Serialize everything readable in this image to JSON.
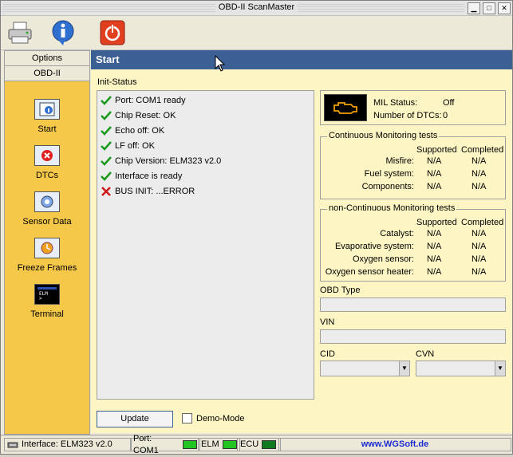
{
  "window": {
    "title": "OBD-II ScanMaster"
  },
  "toolbar": {
    "print_label": "Print",
    "info_label": "Info",
    "power_label": "Exit"
  },
  "sidebar": {
    "tabs": [
      "Options",
      "OBD-II"
    ],
    "items": [
      {
        "label": "Start",
        "icon": "start-icon"
      },
      {
        "label": "DTCs",
        "icon": "dtcs-icon"
      },
      {
        "label": "Sensor Data",
        "icon": "sensor-data-icon"
      },
      {
        "label": "Freeze Frames",
        "icon": "freeze-frames-icon"
      },
      {
        "label": "Terminal",
        "icon": "terminal-icon"
      }
    ]
  },
  "main": {
    "title": "Start",
    "init_status_label": "Init-Status",
    "init_lines": [
      {
        "text": "Port: COM1 ready",
        "ok": true
      },
      {
        "text": "Chip Reset: OK",
        "ok": true
      },
      {
        "text": "Echo off: OK",
        "ok": true
      },
      {
        "text": "LF off: OK",
        "ok": true
      },
      {
        "text": "Chip Version: ELM323 v2.0",
        "ok": true
      },
      {
        "text": "Interface is ready",
        "ok": true
      },
      {
        "text": "BUS INIT: ...ERROR",
        "ok": false
      }
    ],
    "mil": {
      "status_label": "MIL Status:",
      "status_value": "Off",
      "dtc_label": "Number of DTCs:",
      "dtc_value": "0"
    },
    "continuous": {
      "title": "Continuous Monitoring tests",
      "supported_header": "Supported",
      "completed_header": "Completed",
      "rows": [
        {
          "name": "Misfire:",
          "supported": "N/A",
          "completed": "N/A"
        },
        {
          "name": "Fuel system:",
          "supported": "N/A",
          "completed": "N/A"
        },
        {
          "name": "Components:",
          "supported": "N/A",
          "completed": "N/A"
        }
      ]
    },
    "noncontinuous": {
      "title": "non-Continuous Monitoring tests",
      "supported_header": "Supported",
      "completed_header": "Completed",
      "rows": [
        {
          "name": "Catalyst:",
          "supported": "N/A",
          "completed": "N/A"
        },
        {
          "name": "Evaporative system:",
          "supported": "N/A",
          "completed": "N/A"
        },
        {
          "name": "Oxygen sensor:",
          "supported": "N/A",
          "completed": "N/A"
        },
        {
          "name": "Oxygen sensor heater:",
          "supported": "N/A",
          "completed": "N/A"
        }
      ]
    },
    "obd_type_label": "OBD Type",
    "vin_label": "VIN",
    "cid_label": "CID",
    "cvn_label": "CVN",
    "update_label": "Update",
    "demo_label": "Demo-Mode"
  },
  "statusbar": {
    "interface": "Interface: ELM323 v2.0",
    "port": "Port: COM1",
    "elm": "ELM",
    "ecu": "ECU",
    "website": "www.WGSoft.de"
  },
  "colors": {
    "header_blue": "#3c5f94",
    "sidebar_yellow": "#f5c84a",
    "panel_cream": "#fdf6c4",
    "led_green_bright": "#22c422",
    "led_green_dark": "#0f7a1e",
    "link_blue": "#1a2ad0"
  }
}
